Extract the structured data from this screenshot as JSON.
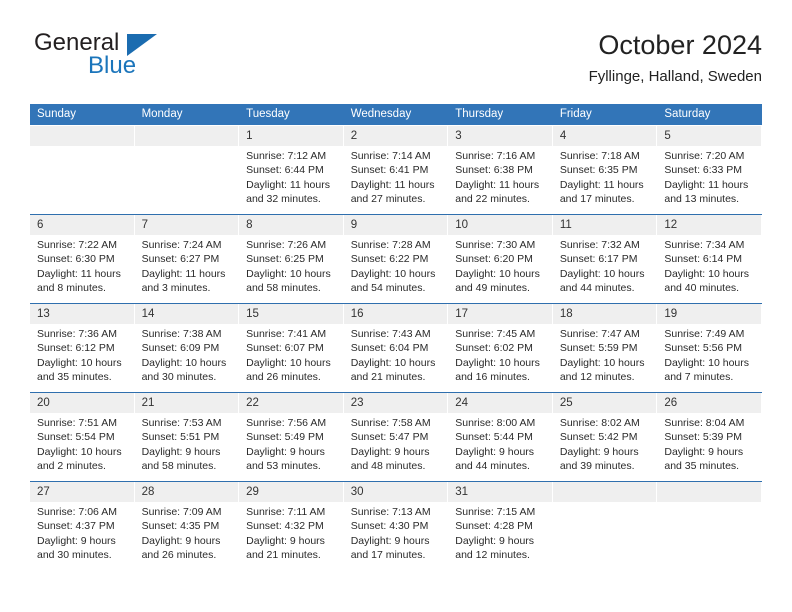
{
  "brand": {
    "name_part1": "General",
    "name_part2": "Blue",
    "triangle_color": "#1b6cb0",
    "blue_text_color": "#1b75bb"
  },
  "header": {
    "title": "October 2024",
    "subtitle": "Fyllinge, Halland, Sweden"
  },
  "theme": {
    "header_blue": "#3275b8",
    "week_rule_blue": "#2f6fae",
    "day_band_gray": "#efefef"
  },
  "weekday_headers": [
    "Sunday",
    "Monday",
    "Tuesday",
    "Wednesday",
    "Thursday",
    "Friday",
    "Saturday"
  ],
  "weeks": [
    [
      {
        "day": "",
        "lines": []
      },
      {
        "day": "",
        "lines": []
      },
      {
        "day": "1",
        "lines": [
          "Sunrise: 7:12 AM",
          "Sunset: 6:44 PM",
          "Daylight: 11 hours",
          "and 32 minutes."
        ]
      },
      {
        "day": "2",
        "lines": [
          "Sunrise: 7:14 AM",
          "Sunset: 6:41 PM",
          "Daylight: 11 hours",
          "and 27 minutes."
        ]
      },
      {
        "day": "3",
        "lines": [
          "Sunrise: 7:16 AM",
          "Sunset: 6:38 PM",
          "Daylight: 11 hours",
          "and 22 minutes."
        ]
      },
      {
        "day": "4",
        "lines": [
          "Sunrise: 7:18 AM",
          "Sunset: 6:35 PM",
          "Daylight: 11 hours",
          "and 17 minutes."
        ]
      },
      {
        "day": "5",
        "lines": [
          "Sunrise: 7:20 AM",
          "Sunset: 6:33 PM",
          "Daylight: 11 hours",
          "and 13 minutes."
        ]
      }
    ],
    [
      {
        "day": "6",
        "lines": [
          "Sunrise: 7:22 AM",
          "Sunset: 6:30 PM",
          "Daylight: 11 hours",
          "and 8 minutes."
        ]
      },
      {
        "day": "7",
        "lines": [
          "Sunrise: 7:24 AM",
          "Sunset: 6:27 PM",
          "Daylight: 11 hours",
          "and 3 minutes."
        ]
      },
      {
        "day": "8",
        "lines": [
          "Sunrise: 7:26 AM",
          "Sunset: 6:25 PM",
          "Daylight: 10 hours",
          "and 58 minutes."
        ]
      },
      {
        "day": "9",
        "lines": [
          "Sunrise: 7:28 AM",
          "Sunset: 6:22 PM",
          "Daylight: 10 hours",
          "and 54 minutes."
        ]
      },
      {
        "day": "10",
        "lines": [
          "Sunrise: 7:30 AM",
          "Sunset: 6:20 PM",
          "Daylight: 10 hours",
          "and 49 minutes."
        ]
      },
      {
        "day": "11",
        "lines": [
          "Sunrise: 7:32 AM",
          "Sunset: 6:17 PM",
          "Daylight: 10 hours",
          "and 44 minutes."
        ]
      },
      {
        "day": "12",
        "lines": [
          "Sunrise: 7:34 AM",
          "Sunset: 6:14 PM",
          "Daylight: 10 hours",
          "and 40 minutes."
        ]
      }
    ],
    [
      {
        "day": "13",
        "lines": [
          "Sunrise: 7:36 AM",
          "Sunset: 6:12 PM",
          "Daylight: 10 hours",
          "and 35 minutes."
        ]
      },
      {
        "day": "14",
        "lines": [
          "Sunrise: 7:38 AM",
          "Sunset: 6:09 PM",
          "Daylight: 10 hours",
          "and 30 minutes."
        ]
      },
      {
        "day": "15",
        "lines": [
          "Sunrise: 7:41 AM",
          "Sunset: 6:07 PM",
          "Daylight: 10 hours",
          "and 26 minutes."
        ]
      },
      {
        "day": "16",
        "lines": [
          "Sunrise: 7:43 AM",
          "Sunset: 6:04 PM",
          "Daylight: 10 hours",
          "and 21 minutes."
        ]
      },
      {
        "day": "17",
        "lines": [
          "Sunrise: 7:45 AM",
          "Sunset: 6:02 PM",
          "Daylight: 10 hours",
          "and 16 minutes."
        ]
      },
      {
        "day": "18",
        "lines": [
          "Sunrise: 7:47 AM",
          "Sunset: 5:59 PM",
          "Daylight: 10 hours",
          "and 12 minutes."
        ]
      },
      {
        "day": "19",
        "lines": [
          "Sunrise: 7:49 AM",
          "Sunset: 5:56 PM",
          "Daylight: 10 hours",
          "and 7 minutes."
        ]
      }
    ],
    [
      {
        "day": "20",
        "lines": [
          "Sunrise: 7:51 AM",
          "Sunset: 5:54 PM",
          "Daylight: 10 hours",
          "and 2 minutes."
        ]
      },
      {
        "day": "21",
        "lines": [
          "Sunrise: 7:53 AM",
          "Sunset: 5:51 PM",
          "Daylight: 9 hours",
          "and 58 minutes."
        ]
      },
      {
        "day": "22",
        "lines": [
          "Sunrise: 7:56 AM",
          "Sunset: 5:49 PM",
          "Daylight: 9 hours",
          "and 53 minutes."
        ]
      },
      {
        "day": "23",
        "lines": [
          "Sunrise: 7:58 AM",
          "Sunset: 5:47 PM",
          "Daylight: 9 hours",
          "and 48 minutes."
        ]
      },
      {
        "day": "24",
        "lines": [
          "Sunrise: 8:00 AM",
          "Sunset: 5:44 PM",
          "Daylight: 9 hours",
          "and 44 minutes."
        ]
      },
      {
        "day": "25",
        "lines": [
          "Sunrise: 8:02 AM",
          "Sunset: 5:42 PM",
          "Daylight: 9 hours",
          "and 39 minutes."
        ]
      },
      {
        "day": "26",
        "lines": [
          "Sunrise: 8:04 AM",
          "Sunset: 5:39 PM",
          "Daylight: 9 hours",
          "and 35 minutes."
        ]
      }
    ],
    [
      {
        "day": "27",
        "lines": [
          "Sunrise: 7:06 AM",
          "Sunset: 4:37 PM",
          "Daylight: 9 hours",
          "and 30 minutes."
        ]
      },
      {
        "day": "28",
        "lines": [
          "Sunrise: 7:09 AM",
          "Sunset: 4:35 PM",
          "Daylight: 9 hours",
          "and 26 minutes."
        ]
      },
      {
        "day": "29",
        "lines": [
          "Sunrise: 7:11 AM",
          "Sunset: 4:32 PM",
          "Daylight: 9 hours",
          "and 21 minutes."
        ]
      },
      {
        "day": "30",
        "lines": [
          "Sunrise: 7:13 AM",
          "Sunset: 4:30 PM",
          "Daylight: 9 hours",
          "and 17 minutes."
        ]
      },
      {
        "day": "31",
        "lines": [
          "Sunrise: 7:15 AM",
          "Sunset: 4:28 PM",
          "Daylight: 9 hours",
          "and 12 minutes."
        ]
      },
      {
        "day": "",
        "lines": []
      },
      {
        "day": "",
        "lines": []
      }
    ]
  ]
}
